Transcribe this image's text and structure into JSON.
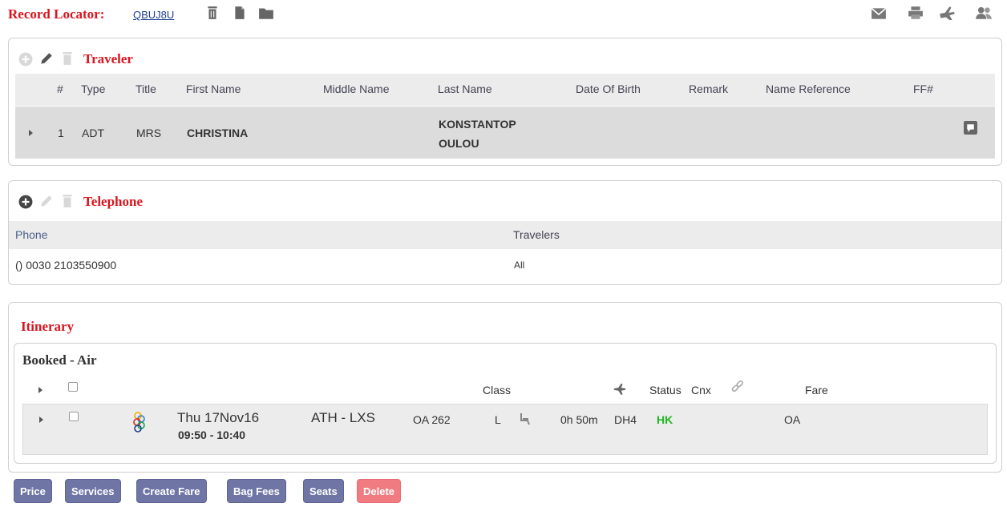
{
  "header": {
    "record_locator_label": "Record Locator:",
    "record_locator_value": "QBUJ8U",
    "actions": [
      "trash-icon",
      "file-icon",
      "folder-icon"
    ],
    "right_actions": [
      "envelope-icon",
      "printer-icon",
      "plane-icon",
      "users-icon"
    ]
  },
  "traveler": {
    "title": "Traveler",
    "columns": [
      "#",
      "Type",
      "Title",
      "First Name",
      "Middle Name",
      "Last Name",
      "Date Of Birth",
      "Remark",
      "Name Reference",
      "FF#"
    ],
    "rows": [
      {
        "num": "1",
        "type": "ADT",
        "title": "MRS",
        "first_name": "CHRISTINA",
        "middle_name": "",
        "last_name_1": "KONSTANTOP",
        "last_name_2": "OULOU",
        "dob": "",
        "remark": "",
        "name_ref": "",
        "ff": ""
      }
    ]
  },
  "telephone": {
    "title": "Telephone",
    "columns": [
      "Phone",
      "Travelers"
    ],
    "rows": [
      {
        "phone": "() 0030 2103550900",
        "travelers": "All"
      }
    ]
  },
  "itinerary": {
    "title": "Itinerary",
    "section": "Booked - Air",
    "columns": {
      "class": "Class",
      "status": "Status",
      "cnx": "Cnx",
      "fare": "Fare"
    },
    "segments": [
      {
        "date": "Thu 17Nov16",
        "times": "09:50 - 10:40",
        "route": "ATH - LXS",
        "flight": "OA 262",
        "class": "L",
        "duration": "0h 50m",
        "equipment": "DH4",
        "status": "HK",
        "fare": "OA"
      }
    ]
  },
  "buttons": {
    "price": "Price",
    "services": "Services",
    "create_fare": "Create Fare",
    "bag_fees": "Bag Fees",
    "seats": "Seats",
    "delete": "Delete"
  },
  "colors": {
    "accent_red": "#d9141e",
    "status_green": "#22b522",
    "button": "#6f76a6",
    "delete": "#f07c82"
  }
}
